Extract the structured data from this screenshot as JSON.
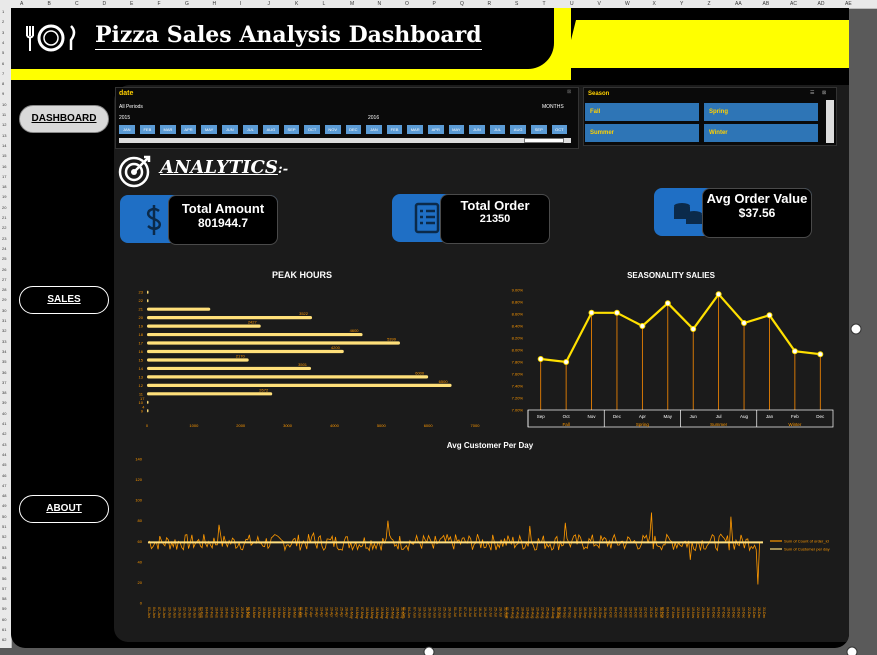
{
  "header": {
    "title": "Pizza Sales Analysis Dashboard"
  },
  "columns": [
    "A",
    "B",
    "C",
    "D",
    "E",
    "F",
    "G",
    "H",
    "I",
    "J",
    "K",
    "L",
    "M",
    "N",
    "O",
    "P",
    "Q",
    "R",
    "S",
    "T",
    "U",
    "V",
    "W",
    "X",
    "Y",
    "Z",
    "AA",
    "AB",
    "AC",
    "AD",
    "AE"
  ],
  "nav": {
    "dashboard": "DASHBOARD",
    "sales": "SALES",
    "about": "ABOUT"
  },
  "date_slicer": {
    "title": "date",
    "period_label": "All Periods",
    "level": "MONTHS",
    "year_left": "2015",
    "year_right": "2016",
    "months": [
      "JAN",
      "FEB",
      "MAR",
      "APR",
      "MAY",
      "JUN",
      "JUL",
      "AUG",
      "SEP",
      "OCT",
      "NOV",
      "DEC",
      "JAN",
      "FEB",
      "MAR",
      "APR",
      "MAY",
      "JUN",
      "JUL",
      "AUG",
      "SEP",
      "OCT"
    ]
  },
  "season_slicer": {
    "title": "Season",
    "items": [
      "Fall",
      "Spring",
      "Summer",
      "Winter"
    ]
  },
  "analytics": {
    "heading": "ANALYTICS",
    "suffix": ":-"
  },
  "kpis": [
    {
      "label": "Total Amount",
      "value": "801944.7",
      "icon": "dollar-icon"
    },
    {
      "label": "Total Order",
      "value": "21350",
      "icon": "checklist-icon"
    },
    {
      "label": "Avg Order Value",
      "value": "$37.56",
      "icon": "coins-icon"
    }
  ],
  "colors": {
    "accent": "#ffff00",
    "blue": "#1f6fc5",
    "orange": "#ff9900",
    "bar": "#ffe07a"
  },
  "chart_data": [
    {
      "type": "bar",
      "title": "PEAK HOURS",
      "orientation": "horizontal",
      "categories": [
        "9",
        "10",
        "11",
        "12",
        "13",
        "14",
        "15",
        "16",
        "17",
        "18",
        "19",
        "20",
        "21",
        "22",
        "23"
      ],
      "values": [
        4,
        17,
        2672,
        6500,
        6000,
        3501,
        2170,
        4200,
        5399,
        4600,
        2427,
        3522,
        1350,
        28,
        3
      ],
      "data_labels": [
        "4",
        "17",
        "2672",
        "6500",
        "6000",
        "3501",
        "2170",
        "4200",
        "5399",
        "4600",
        "2427",
        "3522",
        "",
        "",
        ""
      ],
      "xlim": [
        0,
        7000
      ],
      "xticks": [
        "0",
        "1000",
        "2000",
        "3000",
        "4000",
        "5000",
        "6000",
        "7000"
      ]
    },
    {
      "type": "line",
      "title": "SEASONALITY SALIES",
      "categories": [
        "Sep",
        "Oct",
        "Nov",
        "Dec",
        "Apr",
        "May",
        "Jun",
        "Jul",
        "Aug",
        "Jan",
        "Feb",
        "Dec"
      ],
      "groups": [
        {
          "name": "Fall",
          "span": 3
        },
        {
          "name": "Spring",
          "span": 3
        },
        {
          "name": "Summer",
          "span": 3
        },
        {
          "name": "Winter",
          "span": 3
        }
      ],
      "values": [
        7.85,
        7.8,
        8.62,
        8.62,
        8.4,
        8.78,
        8.35,
        8.93,
        8.45,
        8.58,
        7.98,
        7.93
      ],
      "yticks": [
        "7.00%",
        "7.20%",
        "7.40%",
        "7.60%",
        "7.80%",
        "8.00%",
        "8.20%",
        "8.40%",
        "8.60%",
        "8.80%",
        "9.00%"
      ],
      "ylim": [
        7.0,
        9.0
      ]
    },
    {
      "type": "line",
      "title": "Avg Customer Per Day",
      "yticks": [
        "0",
        "20",
        "40",
        "60",
        "80",
        "100",
        "120",
        "140"
      ],
      "ylim": [
        0,
        140
      ],
      "x_label_pattern": "01-Jan … 31-Dec (daily)",
      "series": [
        {
          "name": "Sum of Count of order_id",
          "spikes": [
            [
              17,
              52
            ],
            [
              42,
              76
            ],
            [
              98,
              68
            ],
            [
              142,
              80
            ],
            [
              169,
              53
            ],
            [
              226,
              75
            ],
            [
              247,
              78
            ],
            [
              298,
              88
            ],
            [
              321,
              42
            ],
            [
              345,
              84
            ],
            [
              361,
              18
            ]
          ]
        },
        {
          "name": "Sum of Customer per day",
          "mean": 59
        }
      ]
    }
  ]
}
